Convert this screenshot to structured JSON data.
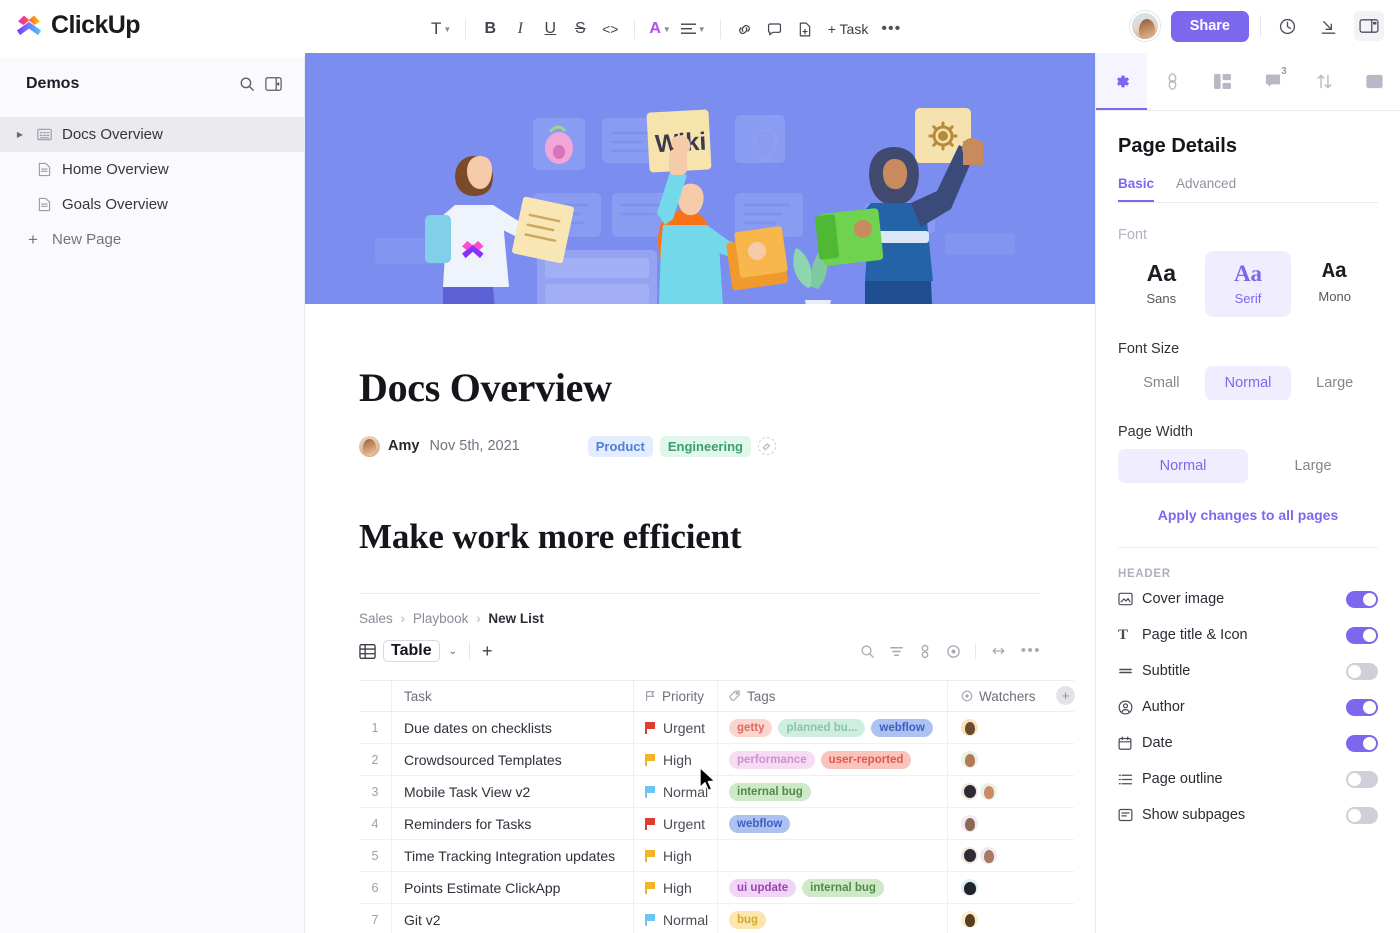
{
  "app": {
    "brand": "ClickUp"
  },
  "toolbar": {
    "text_style": "T",
    "bold": "B",
    "italic": "I",
    "underline": "U",
    "strikethrough": "S",
    "code": "<>",
    "color": "A",
    "align": "align-icon",
    "link": "link-icon",
    "comment": "comment-icon",
    "page": "page-icon",
    "add_task": "+ Task",
    "more": "•••"
  },
  "topright": {
    "share_label": "Share",
    "history_icon": "clock-icon",
    "import_icon": "download-icon",
    "panel_icon": "panel-toggle-icon"
  },
  "sidebar": {
    "title": "Demos",
    "search_icon": "search-icon",
    "collapse_icon": "collapse-sidebar-icon",
    "items": [
      {
        "label": "Docs Overview",
        "icon": "doc-grid-icon",
        "selected": true,
        "expandable": true
      },
      {
        "label": "Home Overview",
        "icon": "page-icon",
        "selected": false,
        "expandable": false
      },
      {
        "label": "Goals Overview",
        "icon": "page-icon",
        "selected": false,
        "expandable": false
      }
    ],
    "new_page": "New Page"
  },
  "doc": {
    "cover_alt": "team posting wiki documents on a wall",
    "wiki_note": "Wiki",
    "title": "Docs Overview",
    "author": "Amy",
    "date": "Nov 5th, 2021",
    "tags": [
      {
        "label": "Product",
        "bg": "#e4edfd",
        "fg": "#4f7fd9"
      },
      {
        "label": "Engineering",
        "bg": "#e2f6ec",
        "fg": "#3aa06b"
      }
    ],
    "heading2": "Make work more efficient"
  },
  "list_view": {
    "breadcrumb": {
      "parts": [
        "Sales",
        "Playbook"
      ],
      "current": "New List"
    },
    "view_name": "Table",
    "add_view": "+",
    "tools": [
      "search-icon",
      "filter-icon",
      "group-icon",
      "eye-icon",
      "expand-icon",
      "more-icon"
    ],
    "columns": [
      {
        "label": "Task",
        "icon": ""
      },
      {
        "label": "Priority",
        "icon": "flag-icon"
      },
      {
        "label": "Tags",
        "icon": "tag-icon"
      },
      {
        "label": "Watchers",
        "icon": "eye-circle-icon"
      }
    ],
    "rows": [
      {
        "num": "1",
        "task": "Due dates on checklists",
        "priority": "Urgent",
        "priority_color": "#e03c31",
        "tags": [
          {
            "label": "getty",
            "bg": "#fbd5d0",
            "fg": "#e2685c"
          },
          {
            "label": "planned bu...",
            "bg": "#cfeee0",
            "fg": "#85c6ac"
          },
          {
            "label": "webflow",
            "bg": "#aec2f0",
            "fg": "#3a5fc4"
          }
        ],
        "watchers": [
          "#f6e3b8"
        ]
      },
      {
        "num": "2",
        "task": "Crowdsourced Templates",
        "priority": "High",
        "priority_color": "#f5b327",
        "tags": [
          {
            "label": "performance",
            "bg": "#f6dcf3",
            "fg": "#cf8fd0"
          },
          {
            "label": "user-reported",
            "bg": "#f9c4bb",
            "fg": "#e0584a"
          }
        ],
        "watchers": [
          "#e6f2e2"
        ]
      },
      {
        "num": "3",
        "task": "Mobile Task View v2",
        "priority": "Normal",
        "priority_color": "#6fc6f0",
        "tags": [
          {
            "label": "internal bug",
            "bg": "#cfe9c8",
            "fg": "#4f8c46"
          }
        ],
        "watchers": [
          "#efe7e0",
          "#e9f2e6"
        ]
      },
      {
        "num": "4",
        "task": "Reminders for Tasks",
        "priority": "Urgent",
        "priority_color": "#e03c31",
        "tags": [
          {
            "label": "webflow",
            "bg": "#aec2f0",
            "fg": "#3a5fc4"
          }
        ],
        "watchers": [
          "#efe9f7"
        ]
      },
      {
        "num": "5",
        "task": "Time Tracking Integration updates",
        "priority": "High",
        "priority_color": "#f5b327",
        "tags": [],
        "watchers": [
          "#efe7e0",
          "#f2e8f5"
        ]
      },
      {
        "num": "6",
        "task": "Points Estimate ClickApp",
        "priority": "High",
        "priority_color": "#f5b327",
        "tags": [
          {
            "label": "ui update",
            "bg": "#f0d6f6",
            "fg": "#9c3fb5"
          },
          {
            "label": "internal bug",
            "bg": "#cfe9c8",
            "fg": "#4f8c46"
          }
        ],
        "watchers": [
          "#d9eef7"
        ]
      },
      {
        "num": "7",
        "task": "Git v2",
        "priority": "Normal",
        "priority_color": "#6fc6f0",
        "tags": [
          {
            "label": "bug",
            "bg": "#fbe7ad",
            "fg": "#d9a62b"
          }
        ],
        "watchers": [
          "#f9efc9"
        ]
      }
    ]
  },
  "panel": {
    "tabs": [
      {
        "icon": "gear-icon",
        "active": true,
        "badge": ""
      },
      {
        "icon": "link-icon",
        "active": false,
        "badge": ""
      },
      {
        "icon": "layout-icon",
        "active": false,
        "badge": ""
      },
      {
        "icon": "comment-icon",
        "active": false,
        "badge": "3"
      },
      {
        "icon": "sort-icon",
        "active": false,
        "badge": ""
      },
      {
        "icon": "image-icon",
        "active": false,
        "badge": ""
      }
    ],
    "title": "Page Details",
    "subtabs": [
      {
        "label": "Basic",
        "active": true
      },
      {
        "label": "Advanced",
        "active": false
      }
    ],
    "font_label": "Font",
    "font_options": [
      {
        "sample": "Aa",
        "label": "Sans",
        "selected": false
      },
      {
        "sample": "Aa",
        "label": "Serif",
        "selected": true
      },
      {
        "sample": "Aa",
        "label": "Mono",
        "selected": false
      }
    ],
    "font_size_label": "Font Size",
    "font_sizes": [
      {
        "label": "Small",
        "selected": false
      },
      {
        "label": "Normal",
        "selected": true
      },
      {
        "label": "Large",
        "selected": false
      }
    ],
    "page_width_label": "Page Width",
    "page_widths": [
      {
        "label": "Normal",
        "selected": true
      },
      {
        "label": "Large",
        "selected": false
      }
    ],
    "apply_link": "Apply changes to all pages",
    "header_section": "HEADER",
    "header_toggles": [
      {
        "label": "Cover image",
        "icon": "image-icon",
        "on": true
      },
      {
        "label": "Page title & Icon",
        "icon": "text-icon",
        "on": true
      },
      {
        "label": "Subtitle",
        "icon": "subtitle-icon",
        "on": false
      },
      {
        "label": "Author",
        "icon": "user-circle-icon",
        "on": true
      },
      {
        "label": "Date",
        "icon": "calendar-icon",
        "on": true
      },
      {
        "label": "Page outline",
        "icon": "list-icon",
        "on": false
      },
      {
        "label": "Show subpages",
        "icon": "subpages-icon",
        "on": false
      }
    ]
  },
  "colors": {
    "accent": "#7b68ee",
    "cover_bg": "#7b8ef0"
  }
}
